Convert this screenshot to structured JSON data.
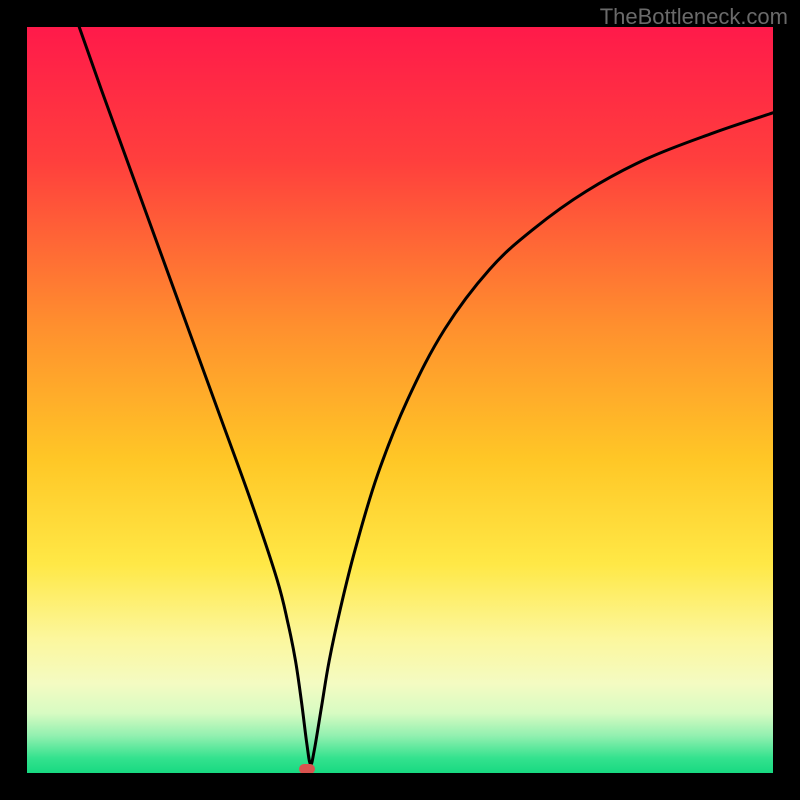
{
  "attribution": "TheBottleneck.com",
  "chart_data": {
    "type": "line",
    "title": "",
    "xlabel": "",
    "ylabel": "",
    "xlim": [
      0,
      100
    ],
    "ylim": [
      0,
      100
    ],
    "gradient_stops": [
      {
        "offset": 0,
        "color": "#ff1a4a"
      },
      {
        "offset": 18,
        "color": "#ff3f3d"
      },
      {
        "offset": 40,
        "color": "#ff8f2e"
      },
      {
        "offset": 58,
        "color": "#ffc726"
      },
      {
        "offset": 72,
        "color": "#ffe846"
      },
      {
        "offset": 82,
        "color": "#fcf79d"
      },
      {
        "offset": 88,
        "color": "#f4fbc2"
      },
      {
        "offset": 92,
        "color": "#d7fbc2"
      },
      {
        "offset": 95,
        "color": "#92f0b0"
      },
      {
        "offset": 98,
        "color": "#34e28e"
      },
      {
        "offset": 100,
        "color": "#17d981"
      }
    ],
    "series": [
      {
        "name": "bottleneck-curve",
        "x": [
          7,
          10,
          14,
          18,
          22,
          26,
          30,
          33.5,
          35,
          36,
          36.8,
          37.5,
          38,
          38.5,
          39.5,
          40.5,
          42,
          44,
          47,
          51,
          56,
          62,
          68,
          75,
          83,
          92,
          100
        ],
        "y": [
          100,
          91.5,
          80.5,
          69.5,
          58.5,
          47.5,
          36.5,
          26,
          20,
          15,
          9.5,
          4,
          1.2,
          3,
          9,
          15,
          22,
          30,
          40,
          50,
          59.5,
          67.5,
          73,
          78,
          82.3,
          85.8,
          88.5
        ]
      }
    ],
    "marker": {
      "x": 37.5,
      "y": 0.5,
      "color": "#d9534f"
    }
  }
}
